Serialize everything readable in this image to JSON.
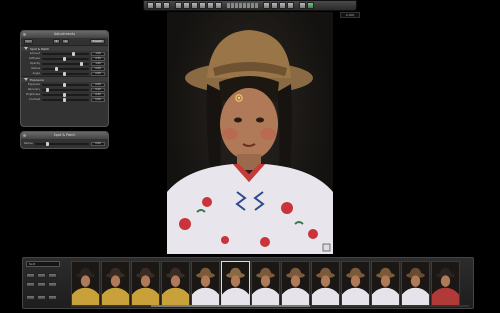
{
  "toolbar": {
    "zoom_badge": "0.000"
  },
  "adjustments": {
    "title": "Adjustments",
    "tabs": [
      "—",
      "▾",
      "▴"
    ],
    "preset_button": "Presets",
    "sections": [
      {
        "name": "Spot & Patch",
        "params": [
          {
            "label": "Amount",
            "value": "1.00",
            "level": 0.7
          },
          {
            "label": "Softness",
            "value": "0.50",
            "level": 0.5
          },
          {
            "label": "Opacity",
            "value": "1.00",
            "level": 0.9
          },
          {
            "label": "Radius",
            "value": "0.00",
            "level": 0.3
          },
          {
            "label": "Angle",
            "value": "0.00",
            "level": 0.5
          }
        ]
      },
      {
        "name": "Exposure",
        "params": [
          {
            "label": "Exposure",
            "value": "0.00",
            "level": 0.5
          },
          {
            "label": "Recovery",
            "value": "0.00",
            "level": 0.1
          },
          {
            "label": "Brightness",
            "value": "0.00",
            "level": 0.5
          },
          {
            "label": "Contrast",
            "value": "0.00",
            "level": 0.5
          }
        ]
      }
    ]
  },
  "spot_patch_hud": {
    "title": "Spot & Patch",
    "param_label": "Radius",
    "param_value": "0.00"
  },
  "filmstrip": {
    "sort_label": "Sort",
    "thumbnail_count": 13,
    "selected_index": 5
  }
}
